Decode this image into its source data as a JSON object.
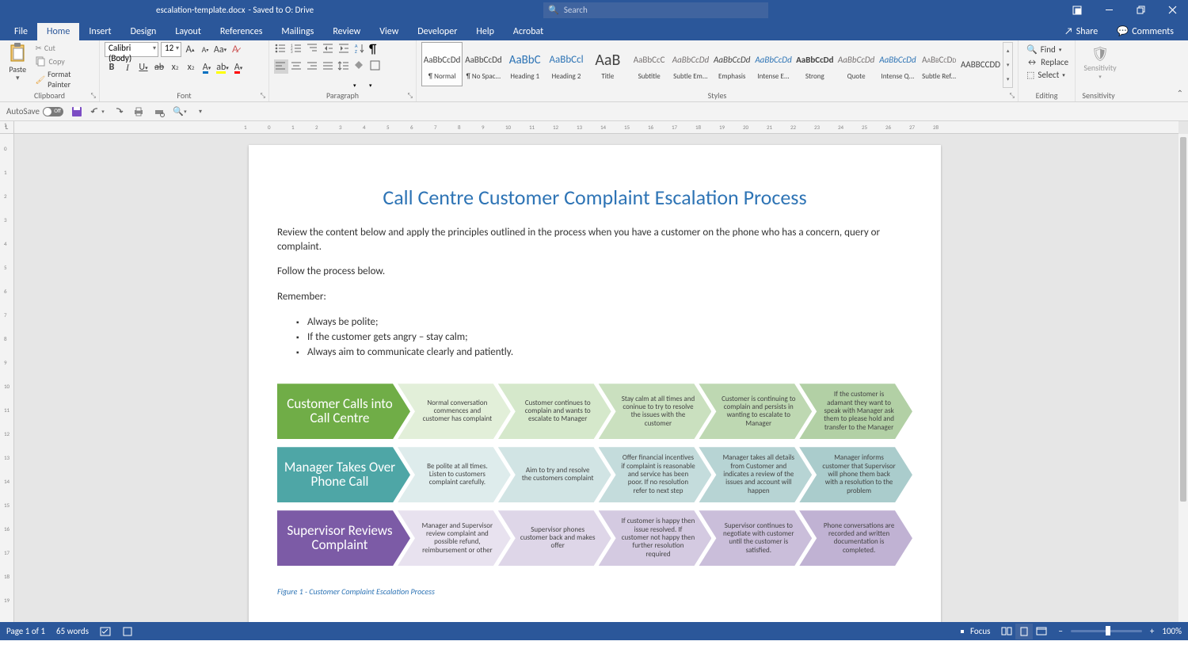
{
  "titlebar": {
    "filename": "escalation-template.docx",
    "saved_to": " -  Saved to O: Drive",
    "search_placeholder": "Search"
  },
  "window_controls": {
    "ribbon_opts": "⊞",
    "minimize": "—",
    "maximize": "❐",
    "close": "✕"
  },
  "menu_tabs": [
    "File",
    "Home",
    "Insert",
    "Design",
    "Layout",
    "References",
    "Mailings",
    "Review",
    "View",
    "Developer",
    "Help",
    "Acrobat"
  ],
  "active_tab": "Home",
  "share": {
    "share": "Share",
    "comments": "Comments"
  },
  "ribbon": {
    "clipboard": {
      "label": "Clipboard",
      "paste": "Paste",
      "cut": "Cut",
      "copy": "Copy",
      "format_painter": "Format Painter"
    },
    "font": {
      "label": "Font",
      "name": "Calibri (Body)",
      "size": "12"
    },
    "paragraph": {
      "label": "Paragraph"
    },
    "styles": {
      "label": "Styles",
      "items": [
        {
          "prev": "AaBbCcDd",
          "name": "¶ Normal",
          "sel": true
        },
        {
          "prev": "AaBbCcDd",
          "name": "¶ No Spac..."
        },
        {
          "prev": "AaBbC",
          "name": "Heading 1",
          "color": "#2e74b5",
          "size": "15px"
        },
        {
          "prev": "AaBbCcl",
          "name": "Heading 2",
          "color": "#2e74b5",
          "size": "13px"
        },
        {
          "prev": "AaB",
          "name": "Title",
          "size": "20px"
        },
        {
          "prev": "AaBbCcC",
          "name": "Subtitle",
          "color": "#767171"
        },
        {
          "prev": "AaBbCcDd",
          "name": "Subtle Em...",
          "color": "#767171",
          "italic": true
        },
        {
          "prev": "AaBbCcDd",
          "name": "Emphasis",
          "italic": true
        },
        {
          "prev": "AaBbCcDd",
          "name": "Intense E...",
          "color": "#2e74b5",
          "italic": true
        },
        {
          "prev": "AaBbCcDd",
          "name": "Strong",
          "bold": true
        },
        {
          "prev": "AaBbCcDd",
          "name": "Quote",
          "italic": true,
          "color": "#767171"
        },
        {
          "prev": "AaBbCcDd",
          "name": "Intense Q...",
          "color": "#2e74b5",
          "italic": true
        },
        {
          "prev": "AaBbCcDd",
          "name": "Subtle Ref...",
          "smallcaps": true,
          "color": "#767171"
        },
        {
          "prev": "AABBCCDD",
          "name": ""
        }
      ]
    },
    "editing": {
      "label": "Editing",
      "find": "Find",
      "replace": "Replace",
      "select": "Select"
    },
    "sensitivity": {
      "label": "Sensitivity",
      "btn": "Sensitivity"
    }
  },
  "qat": {
    "autosave": "AutoSave",
    "off": "Off"
  },
  "doc": {
    "title": "Call Centre Customer Complaint Escalation Process",
    "p1": "Review the content below and apply the principles outlined in the process when you have a customer on the phone who has a concern, query or complaint.",
    "p2": "Follow the process below.",
    "p3": "Remember:",
    "bullets": [
      "Always be polite;",
      "If the customer gets angry – stay calm;",
      "Always aim to communicate clearly and patiently."
    ],
    "rows": [
      {
        "head": "Customer Calls into Call Centre",
        "steps": [
          "Normal conversation commences and customer has complaint",
          "Customer continues to complain and wants to escalate to Manager",
          "Stay calm at all times and coninue to try to resolve the issues with the customer",
          "Customer is continuing to complain and persists in wanting to escalate to Manager",
          "If the customer is adamant they want to speak with Manager ask them to please hold and transfer to the Manager"
        ]
      },
      {
        "head": "Manager Takes Over Phone Call",
        "steps": [
          "Be polite at all times. Listen to customers complaint carefully.",
          "Aim to try and resolve the customers complaint",
          "Offer financial incentives if complaint is reasonable and service has been poor. If no resolution refer to next step",
          "Manager takes all details from Customer and indicates a review of the issues and account will happen",
          "Manager informs customer that Supervisor will phone them back with a resolution to the problem"
        ]
      },
      {
        "head": "Supervisor Reviews Complaint",
        "steps": [
          "Manager and Supervisor review complaint and possible refund, reimbursement or other",
          "Supervisor phones customer back and makes offer",
          "If customer is happy then issue resolved. If customer not happy then further resolution required",
          "Supervisor continues to negotiate with customer until the customer is satisfied.",
          "Phone conversations are recorded and written documentation is completed."
        ]
      }
    ],
    "caption": "Figure 1 - Customer Complaint Escalation Process"
  },
  "status": {
    "page": "Page 1 of 1",
    "words": "65 words",
    "focus": "Focus",
    "zoom": "100%"
  }
}
